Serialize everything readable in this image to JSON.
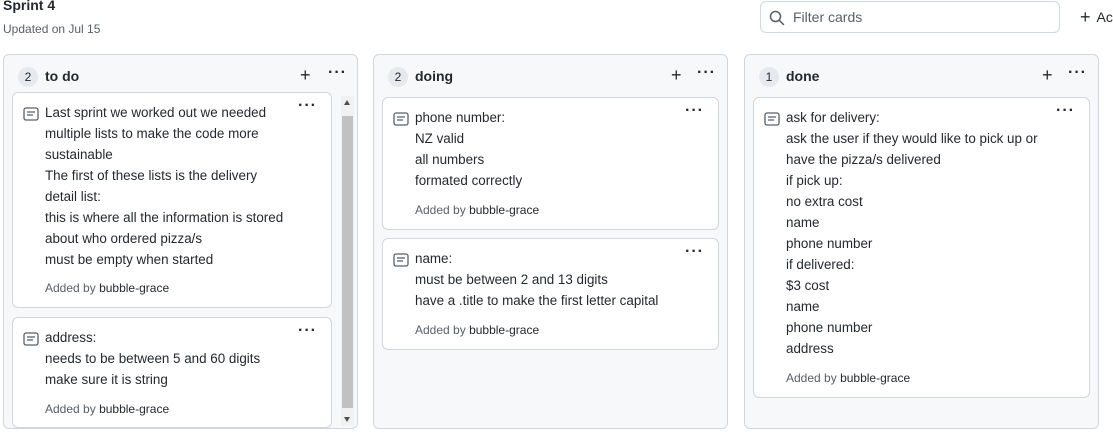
{
  "project": {
    "title": "Sprint 4",
    "updated": "Updated on Jul 15"
  },
  "filter": {
    "placeholder": "Filter cards"
  },
  "add_column_label": "Ac",
  "columns": [
    {
      "count": "2",
      "name": "to do",
      "cards": [
        {
          "lines": [
            "Last sprint we worked out we needed",
            "multiple lists to make the code more",
            "sustainable",
            "The first of these lists is the delivery",
            "detail list:",
            "this is where all the information is stored",
            "about who ordered pizza/s",
            "must be empty when started"
          ],
          "added_prefix": "Added by",
          "added_user": "bubble-grace"
        },
        {
          "lines": [
            "address:",
            "needs to be between 5 and 60 digits",
            "make sure it is string"
          ],
          "added_prefix": "Added by",
          "added_user": "bubble-grace"
        }
      ]
    },
    {
      "count": "2",
      "name": "doing",
      "cards": [
        {
          "lines": [
            "phone number:",
            "NZ valid",
            "all numbers",
            "formated correctly"
          ],
          "added_prefix": "Added by",
          "added_user": "bubble-grace"
        },
        {
          "lines": [
            "name:",
            "must be between 2 and 13 digits",
            "have a .title to make the first letter capital"
          ],
          "added_prefix": "Added by",
          "added_user": "bubble-grace"
        }
      ]
    },
    {
      "count": "1",
      "name": "done",
      "cards": [
        {
          "lines": [
            "ask for delivery:",
            "ask the user if they would like to pick up or",
            "have the pizza/s delivered",
            "if pick up:",
            "no extra cost",
            "name",
            "phone number",
            "if delivered:",
            "$3 cost",
            "name",
            "phone number",
            "address"
          ],
          "added_prefix": "Added by",
          "added_user": "bubble-grace"
        }
      ]
    }
  ]
}
